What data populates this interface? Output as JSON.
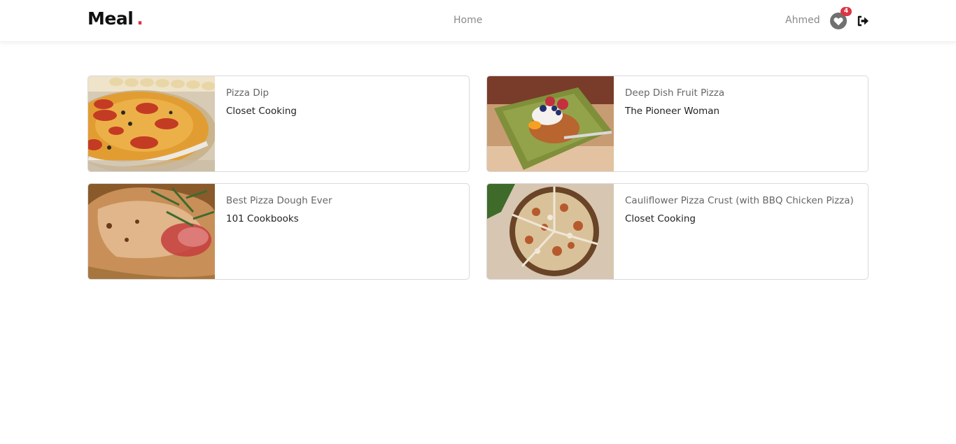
{
  "navbar": {
    "brand": "Meal",
    "brand_dot": ".",
    "home_label": "Home",
    "user_name": "Ahmed",
    "favorites_count": "4",
    "favorites_icon": "heart-icon",
    "logout_icon": "sign-out-icon"
  },
  "colors": {
    "accent": "#dc3545",
    "muted_text": "#8a8a8a",
    "card_border": "#d9d9d9"
  },
  "recipes": [
    {
      "title": "Pizza Dip",
      "publisher": "Closet Cooking",
      "image": "pizza-dip-photo"
    },
    {
      "title": "Deep Dish Fruit Pizza",
      "publisher": "The Pioneer Woman",
      "image": "fruit-pizza-photo"
    },
    {
      "title": "Best Pizza Dough Ever",
      "publisher": "101 Cookbooks",
      "image": "pizza-dough-photo"
    },
    {
      "title": "Cauliflower Pizza Crust (with BBQ Chicken Pizza)",
      "publisher": "Closet Cooking",
      "image": "cauliflower-pizza-photo"
    }
  ]
}
